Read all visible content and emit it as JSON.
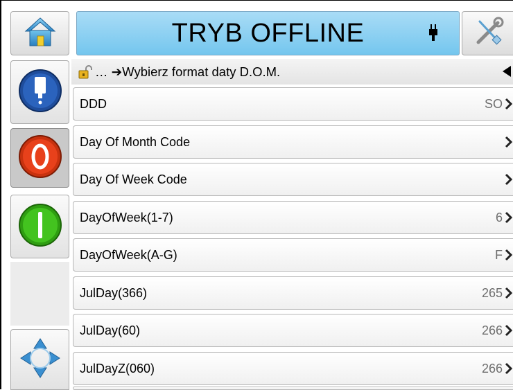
{
  "header": {
    "title": "TRYB OFFLINE"
  },
  "breadcrumb": {
    "text": "… ➔Wybierz format daty D.O.M."
  },
  "list": [
    {
      "label": "DDD",
      "value": "SO"
    },
    {
      "label": "Day Of Month Code",
      "value": ""
    },
    {
      "label": "Day Of Week Code",
      "value": ""
    },
    {
      "label": "DayOfWeek(1-7)",
      "value": "6"
    },
    {
      "label": "DayOfWeek(A-G)",
      "value": "F"
    },
    {
      "label": "JulDay(366)",
      "value": "265"
    },
    {
      "label": "JulDay(60)",
      "value": "266"
    },
    {
      "label": "JulDayZ(060)",
      "value": "266"
    }
  ],
  "icons": {
    "home": "home-icon",
    "connection": "plug-icon",
    "tools": "tools-icon",
    "job": "print-job-icon",
    "stop": "stop-icon",
    "start": "start-icon",
    "navigate": "navigation-arrows-icon",
    "lock": "padlock-icon",
    "back": "back-arrow-icon"
  },
  "colors": {
    "title_bar": "#74c6ee",
    "stop": "#e8411b",
    "start": "#43c31f",
    "job": "#1f4d9c",
    "nav_arrows": "#3a8fd0"
  }
}
